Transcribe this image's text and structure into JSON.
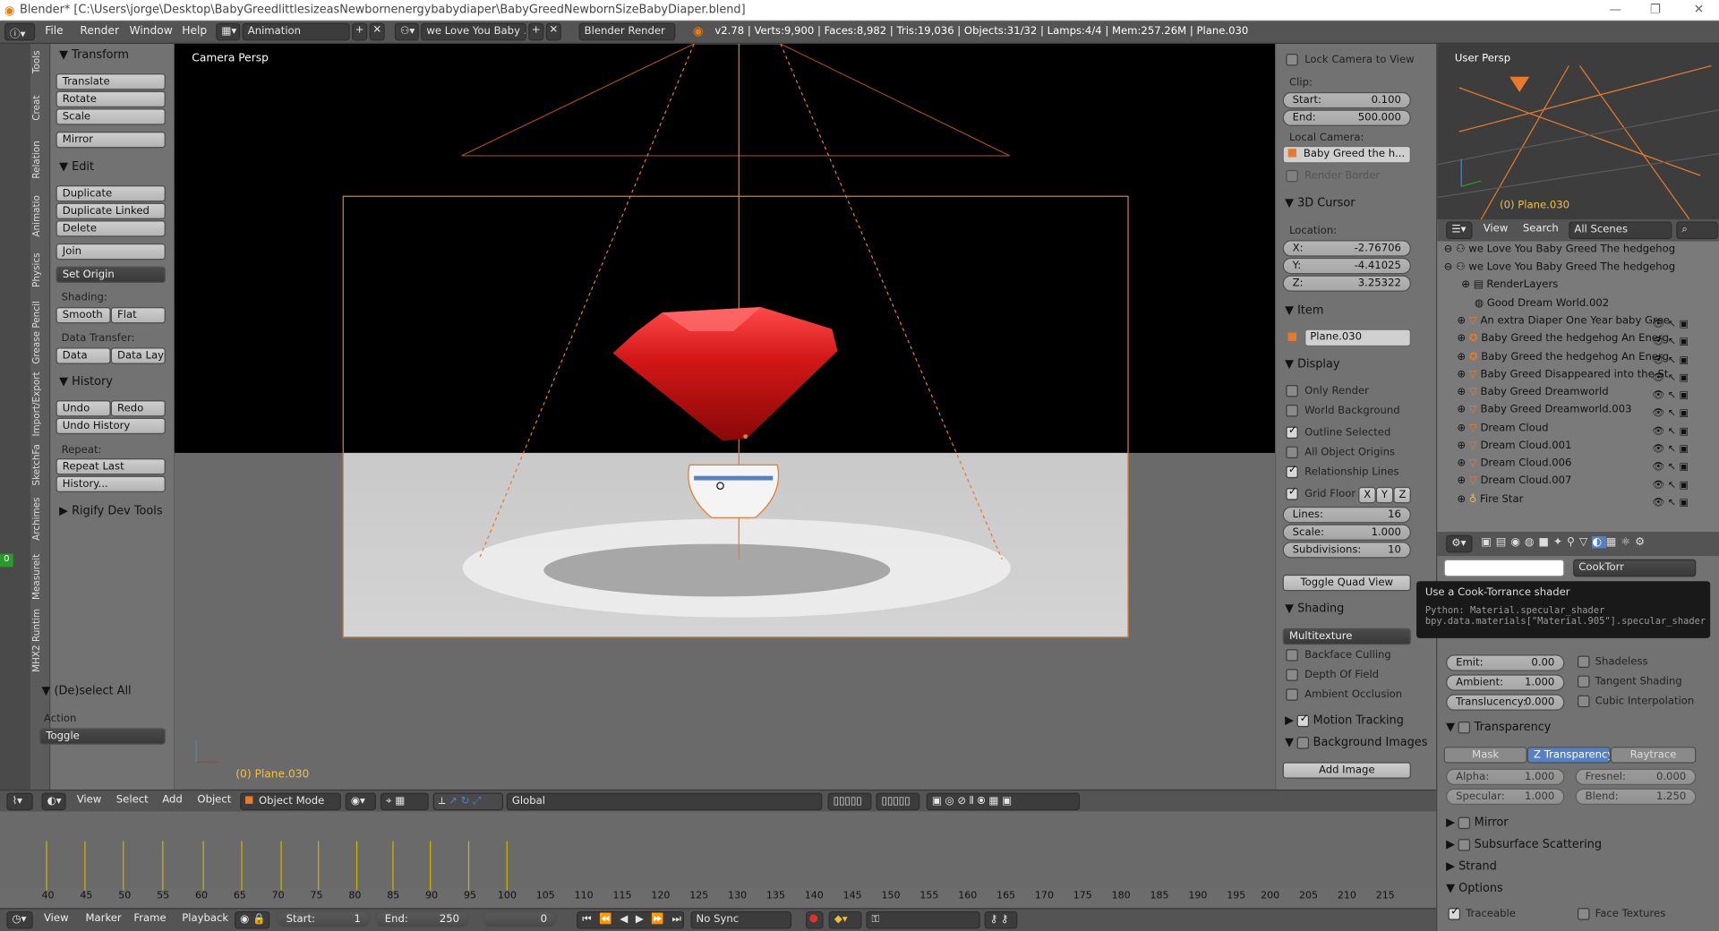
{
  "window": {
    "title": "Blender* [C:\\Users\\jorge\\Desktop\\BabyGreedlittlesizeasNewbornenergybabydiaper\\BabyGreedNewbornSizeBabyDiaper.blend]",
    "minimize": "—",
    "maximize": "❐",
    "close": "✕"
  },
  "topbar": {
    "menus": [
      "File",
      "Render",
      "Window",
      "Help"
    ],
    "screen_layout": "Animation",
    "scene": "we Love You Baby ...",
    "engine": "Blender Render",
    "info": "v2.78 | Verts:9,900 | Faces:8,982 | Tris:19,036 | Objects:31/32 | Lamps:4/4 | Mem:257.26M | Plane.030"
  },
  "tool_tabs": [
    "Tools",
    "Creat",
    "Relation",
    "Animatio",
    "Physics",
    "Grease Pencil",
    "Import/Export",
    "SketchFa",
    "Archimes",
    "Measureit",
    "MHX2 Runtim"
  ],
  "tools": {
    "transform_title": "Transform",
    "translate": "Translate",
    "rotate": "Rotate",
    "scale": "Scale",
    "mirror": "Mirror",
    "edit_title": "Edit",
    "duplicate": "Duplicate",
    "duplicate_linked": "Duplicate Linked",
    "delete": "Delete",
    "join": "Join",
    "set_origin": "Set Origin",
    "shading_label": "Shading:",
    "smooth": "Smooth",
    "flat": "Flat",
    "data_transfer_label": "Data Transfer:",
    "data": "Data",
    "data_layo": "Data Layo",
    "history_title": "History",
    "undo": "Undo",
    "redo": "Redo",
    "undo_history": "Undo History",
    "repeat_label": "Repeat:",
    "repeat_last": "Repeat Last",
    "history_dots": "History...",
    "rigify_title": "Rigify Dev Tools",
    "deselect_title": "(De)select All",
    "action_label": "Action",
    "action_value": "Toggle"
  },
  "viewport": {
    "label": "Camera Persp",
    "object_label": "(0) Plane.030"
  },
  "view_props": {
    "lock_camera": "Lock Camera to View",
    "clip_label": "Clip:",
    "start_label": "Start:",
    "start_value": "0.100",
    "end_label": "End:",
    "end_value": "500.000",
    "local_camera_label": "Local Camera:",
    "local_camera_value": "Baby Greed  the h...",
    "render_border": "Render Border",
    "cursor_title": "3D Cursor",
    "location_label": "Location:",
    "x_label": "X:",
    "x_value": "-2.76706",
    "y_label": "Y:",
    "y_value": "-4.41025",
    "z_label": "Z:",
    "z_value": "3.25322",
    "item_title": "Item",
    "item_name": "Plane.030",
    "display_title": "Display",
    "only_render": "Only Render",
    "world_background": "World Background",
    "outline_selected": "Outline Selected",
    "all_object_origins": "All Object Origins",
    "relationship_lines": "Relationship Lines",
    "grid_floor": "Grid Floor",
    "gx": "X",
    "gy": "Y",
    "gz": "Z",
    "lines_label": "Lines:",
    "lines_value": "16",
    "scale_label": "Scale:",
    "scale_value": "1.000",
    "subdiv_label": "Subdivisions:",
    "subdiv_value": "10",
    "toggle_quad": "Toggle Quad View",
    "shading_title": "Shading",
    "shading_mode": "Multitexture",
    "backface": "Backface Culling",
    "dof": "Depth Of Field",
    "ao": "Ambient Occlusion",
    "motion_tracking": "Motion Tracking",
    "background_images": "Background Images",
    "add_image": "Add Image"
  },
  "mini_viewport": {
    "label": "User Persp",
    "object_label": "(0) Plane.030"
  },
  "outliner": {
    "view": "View",
    "search": "Search",
    "filter": "All Scenes",
    "rows": [
      "we Love You Baby Greed The hedgehog",
      "we Love You Baby Greed The hedgehog",
      "RenderLayers",
      "Good Dream World.002",
      "An extra Diaper One Year baby Gree",
      "Baby Greed  the hedgehog An  Energ",
      "Baby Greed  the hedgehog An  Energ",
      "Baby Greed Disappeared into the St",
      "Baby Greed Dreamworld",
      "Baby Greed Dreamworld.003",
      "Dream Cloud",
      "Dream Cloud.001",
      "Dream Cloud.006",
      "Dream Cloud.007",
      "Fire Star"
    ]
  },
  "material": {
    "specular_shader": "CookTorr",
    "tooltip_title": "Use a Cook-Torrance shader",
    "tooltip_python1": "Python: Material.specular_shader",
    "tooltip_python2": "bpy.data.materials[\"Material.905\"].specular_shader",
    "emit_label": "Emit:",
    "emit_value": "0.00",
    "ambient_label": "Ambient:",
    "ambient_value": "1.000",
    "translucency_label": "Translucency:",
    "translucency_value": "0.000",
    "shadeless": "Shadeless",
    "tangent_shading": "Tangent Shading",
    "cubic_interp": "Cubic Interpolation",
    "transparency_title": "Transparency",
    "mask": "Mask",
    "z_transparency": "Z Transparency",
    "raytrace": "Raytrace",
    "alpha_label": "Alpha:",
    "alpha_value": "1.000",
    "fresnel_label": "Fresnel:",
    "fresnel_value": "0.000",
    "specular_label": "Specular:",
    "specular_value": "1.000",
    "blend_label": "Blend:",
    "blend_value": "1.250",
    "mirror_title": "Mirror",
    "sss_title": "Subsurface Scattering",
    "strand_title": "Strand",
    "options_title": "Options",
    "traceable": "Traceable",
    "face_textures": "Face Textures"
  },
  "viewport_header": {
    "view": "View",
    "select": "Select",
    "add": "Add",
    "object": "Object",
    "mode": "Object Mode",
    "orientation": "Global"
  },
  "timeline": {
    "ticks": [
      "40",
      "45",
      "50",
      "55",
      "60",
      "65",
      "70",
      "75",
      "80",
      "85",
      "90",
      "95",
      "100",
      "105",
      "110",
      "115",
      "120",
      "125",
      "130",
      "135",
      "140",
      "145",
      "150",
      "155",
      "160",
      "165",
      "170",
      "175",
      "180",
      "185",
      "190",
      "195",
      "200",
      "205",
      "210",
      "215"
    ],
    "view": "View",
    "marker": "Marker",
    "frame": "Frame",
    "playback": "Playback",
    "start_label": "Start:",
    "start_value": "1",
    "end_label": "End:",
    "end_value": "250",
    "current": "0",
    "sync": "No Sync"
  },
  "colors": {
    "header_bg": "#545454",
    "panel_bg": "#727272",
    "accent_blue": "#5680c2",
    "gem_red": "#d01818",
    "selection_orange": "#e87a2a",
    "keyframe_yellow": "#c9b600"
  }
}
